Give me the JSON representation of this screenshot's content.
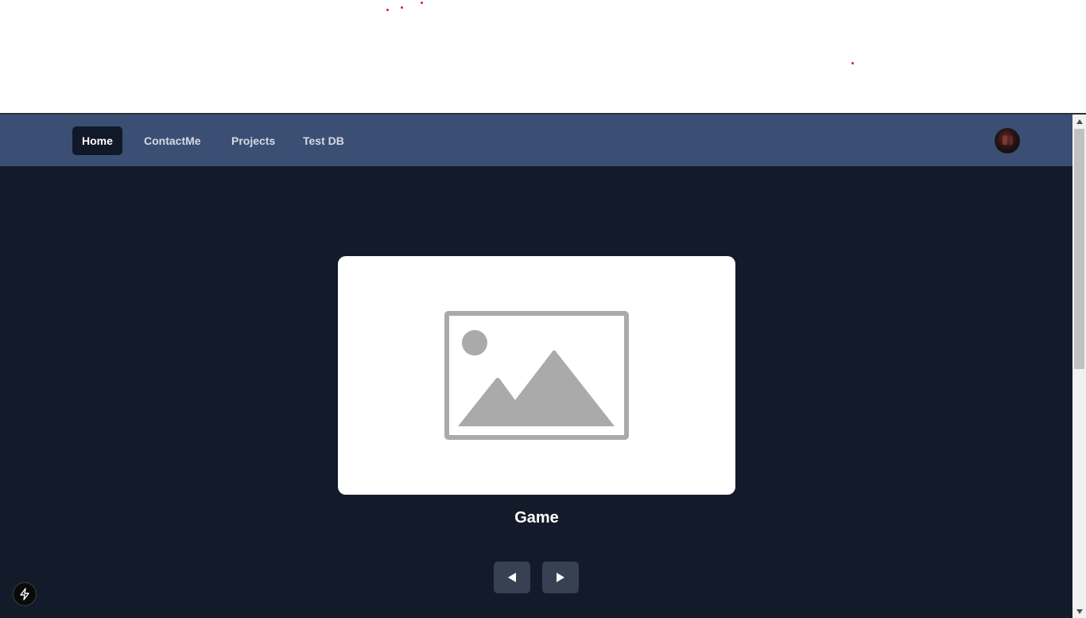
{
  "nav": {
    "items": [
      {
        "label": "Home",
        "active": true
      },
      {
        "label": "ContactMe",
        "active": false
      },
      {
        "label": "Projects",
        "active": false
      },
      {
        "label": "Test DB",
        "active": false
      }
    ],
    "avatar_icon": "user-avatar"
  },
  "carousel": {
    "current_title": "Game",
    "image_icon": "image-placeholder-icon",
    "prev_icon": "triangle-left-icon",
    "next_icon": "triangle-right-icon"
  },
  "dev_tools": {
    "icon": "lightning-bolt-icon"
  },
  "colors": {
    "navbar": "#3a4f73",
    "background": "#131a29",
    "active_nav": "#111827",
    "arrow_button": "#374151",
    "placeholder_gray": "#aaaaaa",
    "dot_red": "#e11d1d"
  }
}
